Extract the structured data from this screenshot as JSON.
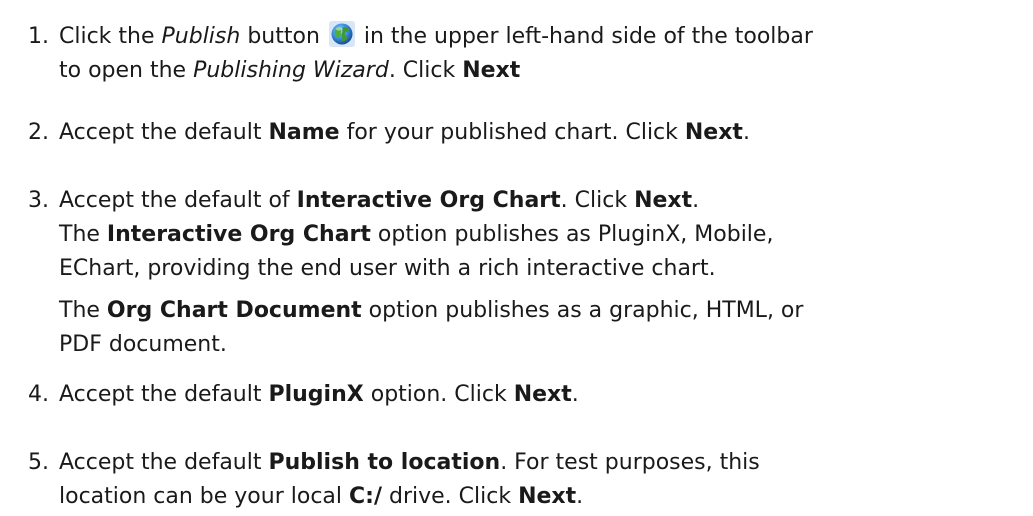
{
  "steps": [
    {
      "number": "1.",
      "line1_a": "Click the ",
      "line1_italic": "Publish",
      "line1_b": " button",
      "icon": "globe-publish-icon",
      "line1_c": " in the upper left-hand side of the toolbar",
      "line2_a": "to open the ",
      "line2_italic": "Publishing Wizard",
      "line2_b": ". Click ",
      "line2_bold": "Next"
    },
    {
      "number": "2.",
      "a": "Accept the default ",
      "bold1": "Name",
      "b": " for your published chart. Click ",
      "bold2": "Next",
      "c": "."
    },
    {
      "number": "3.",
      "a": "Accept the default of ",
      "bold1": "Interactive Org Chart",
      "b": ". Click ",
      "bold2": "Next",
      "c": ".",
      "p2_bold": "Interactive Org Chart",
      "p2_a": "The ",
      "p2_b": " option publishes as PluginX, Mobile,",
      "p2_line2": "EChart, providing the end user with a rich interactive chart.",
      "p3_a": "The ",
      "p3_bold": "Org Chart Document",
      "p3_b": " option publishes as a graphic, HTML, or",
      "p3_line2": "PDF document."
    },
    {
      "number": "4.",
      "a": "Accept the default ",
      "bold1": "PluginX",
      "b": " option. Click ",
      "bold2": "Next",
      "c": "."
    },
    {
      "number": "5.",
      "a": "Accept the default ",
      "bold1": "Publish to location",
      "b": ". For test purposes, this",
      "line2_a": "location can be your local ",
      "line2_bold1": "C:/",
      "line2_b": " drive. Click ",
      "line2_bold2": "Next",
      "line2_c": "."
    }
  ]
}
